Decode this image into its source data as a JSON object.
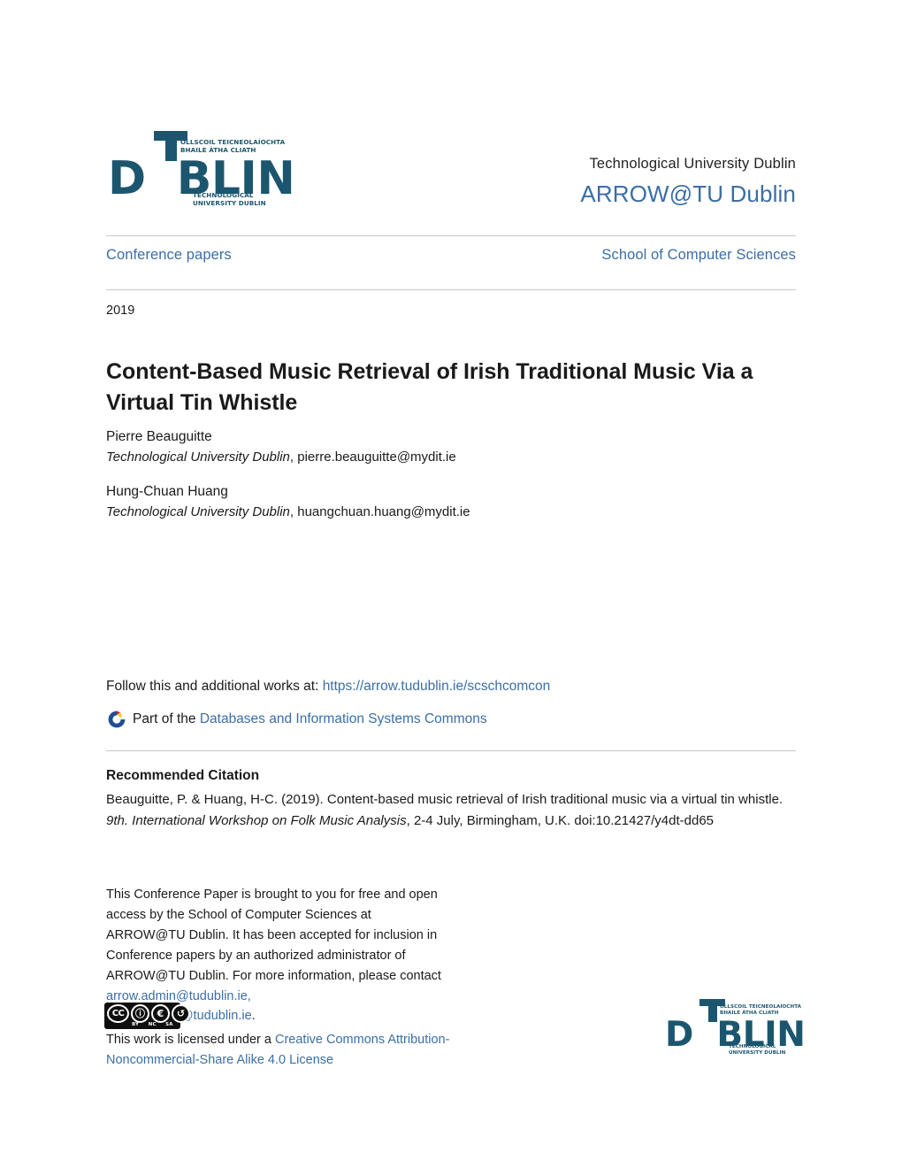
{
  "header": {
    "logo": {
      "wordmark": "D  BLIN",
      "letters": "DUBLIN",
      "irish_line1": "OLLSCOIL TEICNEOLAÍOCHTA",
      "irish_line2": "BHAILE ÁTHA CLIATH",
      "english_line1": "TECHNOLOGICAL",
      "english_line2": "UNIVERSITY DUBLIN"
    },
    "university": "Technological University Dublin",
    "repository": "ARROW@TU Dublin"
  },
  "nav": {
    "left": "Conference papers",
    "right": "School of Computer Sciences"
  },
  "paper": {
    "year": "2019",
    "title": "Content-Based Music Retrieval of Irish Traditional Music Via a Virtual Tin Whistle",
    "authors": [
      {
        "name": "Pierre Beauguitte",
        "institution": "Technological University Dublin",
        "email": "pierre.beauguitte@mydit.ie"
      },
      {
        "name": "Hung-Chuan Huang",
        "institution": "Technological University Dublin",
        "email": "huangchuan.huang@mydit.ie"
      }
    ]
  },
  "follow": {
    "prefix": "Follow this and additional works at:",
    "url": "https://arrow.tudublin.ie/scschcomcon",
    "part_of_prefix": "Part of the",
    "commons_link": "Databases and Information Systems Commons",
    "icon": "commons-wheel-icon"
  },
  "citation": {
    "heading": "Recommended Citation",
    "text_part_1": "Beauguitte, P. & Huang, H-C. (2019). Content-based music retrieval of Irish traditional music via a virtual tin whistle. ",
    "italic_part": "9th. International Workshop on Folk Music Analysis",
    "text_part_2": ", 2-4 July, Birmingham, U.K. doi:10.21427/y4dt-dd65"
  },
  "footer_note": {
    "text_before_links": "This Conference Paper is brought to you for free and open access by the School of Computer Sciences at ARROW@TU Dublin. It has been accepted for inclusion in Conference papers by an authorized administrator of ARROW@TU Dublin. For more information, please contact ",
    "email_1": "arrow.admin@tudublin.ie,",
    "email_2": "aisling.coyne@tudublin.ie",
    "text_after_links": "."
  },
  "license": {
    "badge": {
      "cc": "CC",
      "by_glyph": "ⓘ",
      "nc_glyph": "€",
      "sa_glyph": "↺",
      "label_cc": "",
      "label_by": "BY",
      "label_nc": "NC",
      "label_sa": "SA"
    },
    "prefix": "This work is licensed under a ",
    "link_text": "Creative Commons Attribution-Noncommercial-Share Alike 4.0 License"
  },
  "colors": {
    "link_blue": "#3b6ea5",
    "logo_teal": "#1b566e",
    "rule_gray": "#c8c8c8",
    "text_black": "#1a1a1a"
  }
}
